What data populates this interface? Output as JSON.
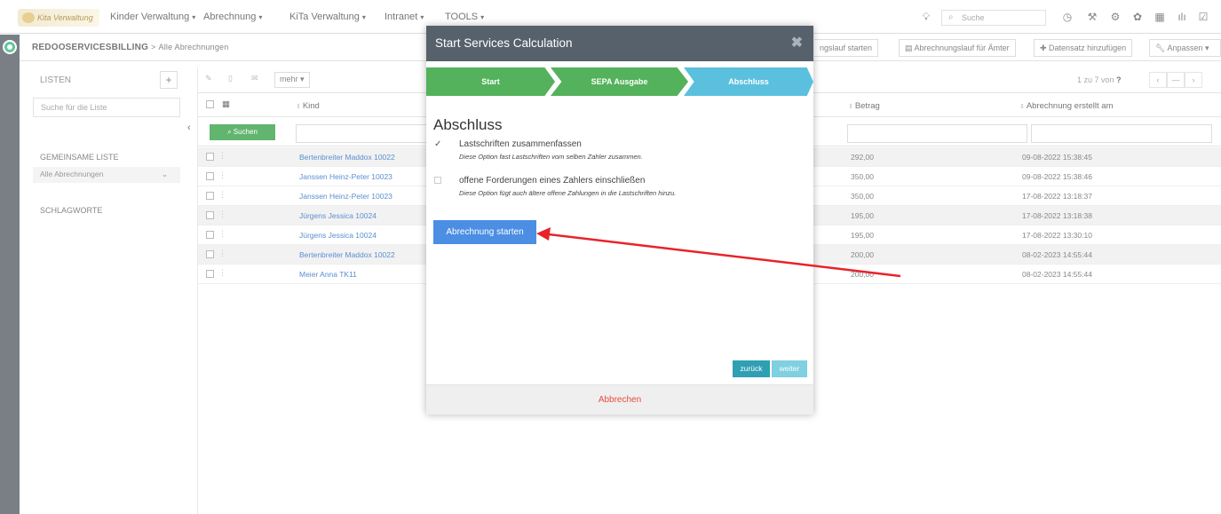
{
  "nav": {
    "logo_text": "Kita Verwaltung",
    "items": [
      {
        "label": "Kinder Verwaltung",
        "caret": "▾"
      },
      {
        "label": "Abrechnung",
        "caret": "▾"
      },
      {
        "label": "KiTa Verwaltung",
        "caret": "▾"
      },
      {
        "label": "Intranet",
        "caret": "▾"
      },
      {
        "label": "TOOLS",
        "caret": "▾"
      }
    ],
    "search_placeholder": "Suche",
    "icons": [
      "bulb-icon",
      "search-icon",
      "clock-icon",
      "tools-icon",
      "gear-icon",
      "settings-icon",
      "calendar-icon",
      "chart-icon",
      "checklist-icon"
    ]
  },
  "breadcrumb": {
    "module": "REDOOSERVICESBILLING",
    "separator": ">",
    "page": "Alle Abrechnungen"
  },
  "actions": {
    "run_label": "ngslauf starten",
    "amt_label": "Abrechnungslauf für Ämter",
    "add_label": "Datensatz hinzufügen",
    "customize_label": "Anpassen"
  },
  "sidebar": {
    "title": "LISTEN",
    "plus": "+",
    "search_placeholder": "Suche für die Liste",
    "shared_label": "GEMEINSAME LISTE",
    "selected_list": "Alle Abrechnungen",
    "tags_label": "SCHLAGWORTE"
  },
  "toolbar": {
    "more_label": "mehr",
    "pager_text": "1 zu 7 von",
    "pager_total": "?",
    "pager_dash": "—"
  },
  "table": {
    "search_button": "Suchen",
    "columns": {
      "kind": "Kind",
      "betrag": "Betrag",
      "created": "Abrechnung erstellt am"
    },
    "rows": [
      {
        "kind": "Bertenbreiter Maddox 10022",
        "betrag": "292,00",
        "date": "09-08-2022 15:38:45"
      },
      {
        "kind": "Janssen Heinz-Peter 10023",
        "betrag": "350,00",
        "date": "09-08-2022 15:38:46"
      },
      {
        "kind": "Janssen Heinz-Peter 10023",
        "betrag": "350,00",
        "date": "17-08-2022 13:18:37"
      },
      {
        "kind": "Jürgens Jessica 10024",
        "betrag": "195,00",
        "date": "17-08-2022 13:18:38"
      },
      {
        "kind": "Jürgens Jessica 10024",
        "betrag": "195,00",
        "date": "17-08-2022 13:30:10"
      },
      {
        "kind": "Bertenbreiter Maddox 10022",
        "betrag": "200,00",
        "date": "08-02-2023 14:55:44"
      },
      {
        "kind": "Meier Anna TK11",
        "betrag": "200,00",
        "date": "08-02-2023 14:55:44"
      }
    ]
  },
  "modal": {
    "title": "Start Services Calculation",
    "close": "✖",
    "steps": [
      "Start",
      "SEPA Ausgabe",
      "Abschluss"
    ],
    "heading": "Abschluss",
    "options": [
      {
        "label": "Lastschriften zusammenfassen",
        "description": "Diese Option fast Lastschriften vom selben Zahler zusammen.",
        "checked": true
      },
      {
        "label": "offene Forderungen eines Zahlers einschließen",
        "description": "Diese Option fügt auch ältere offene Zahlungen in die Lastschriften hinzu.",
        "checked": false
      }
    ],
    "start_button": "Abrechnung starten",
    "back_button": "zurück",
    "next_button": "weiter",
    "cancel_button": "Abbrechen"
  },
  "colors": {
    "step_done": "#53b25b",
    "step_active": "#5bc0de",
    "primary_button": "#4b8ee3",
    "cancel_text": "#e74c3c",
    "annotation_arrow": "#e8232a"
  }
}
